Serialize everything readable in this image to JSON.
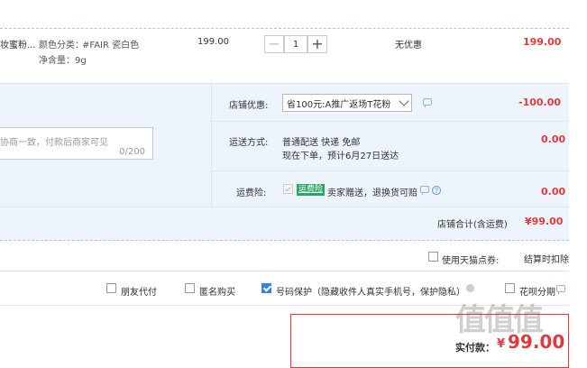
{
  "product": {
    "title_fragment": "妆蜜粉...",
    "sku_color_label": "颜色分类：",
    "sku_color_value": "#FAIR 瓷白色",
    "sku_content": "净含量：9g",
    "unit_price": "199.00",
    "quantity": "1",
    "quantity_minus": "−",
    "quantity_plus": "+",
    "discount": "无优惠",
    "subtotal": "199.00"
  },
  "message": {
    "placeholder": "协商一致，付款后商家可见",
    "counter": "0/200"
  },
  "shop_discount": {
    "label": "店铺优惠:",
    "selected": "省100元:A推广返场T花粉",
    "amount": "-100.00"
  },
  "shipping": {
    "label": "运送方式:",
    "method": "普通配送 快递 免邮",
    "eta": "现在下单，预计6月27日送达",
    "amount": "0.00"
  },
  "insurance": {
    "label": "运费险:",
    "badge": "运费险",
    "text": "卖家赠送，退换货可赔",
    "help": "?",
    "amount": "0.00"
  },
  "shop_total": {
    "label": "店铺合计(含运费)",
    "amount": "¥99.00"
  },
  "points": {
    "label": "使用天猫点券:",
    "note": "结算时扣除"
  },
  "options": {
    "friend_pay": "朋友代付",
    "anonymous": "匿名购买",
    "number_protect": "号码保护（隐藏收件人真实手机号，保护隐私）",
    "huabei": "花呗分期"
  },
  "payment": {
    "label": "实付款：",
    "currency": "¥",
    "amount": "99.00"
  },
  "colors": {
    "price_red": "#e4393c",
    "panel_blue": "#eef4fb",
    "check_blue": "#3a82d6",
    "insurance_green": "#2aa566"
  }
}
